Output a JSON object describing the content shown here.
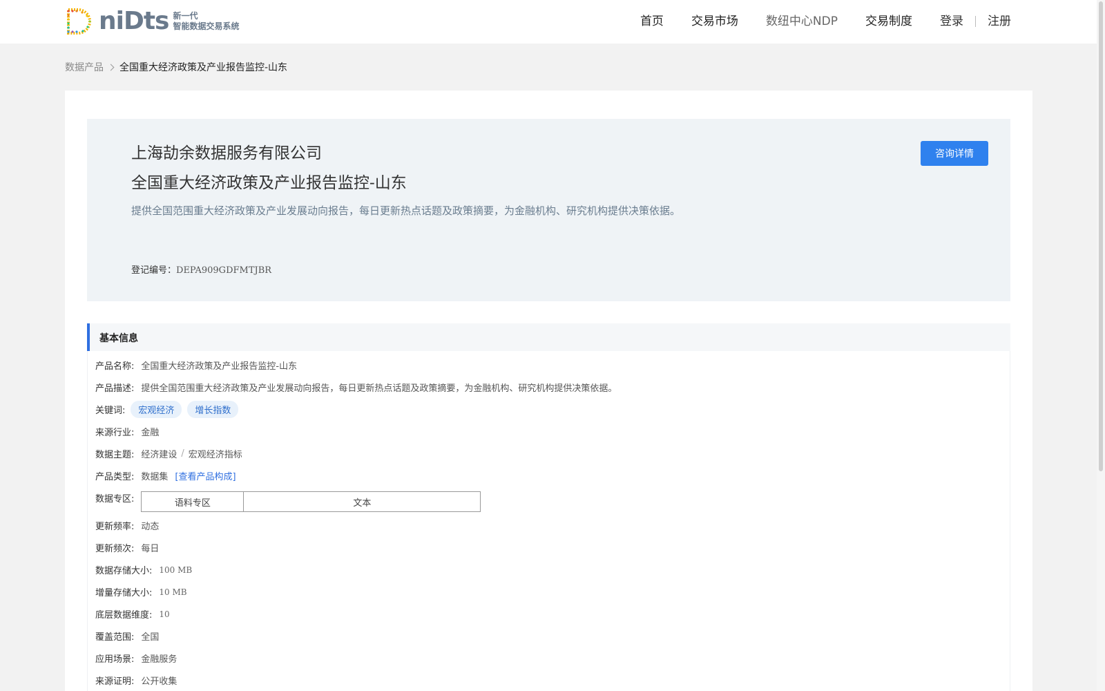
{
  "header": {
    "logo_word": "niDts",
    "logo_line1": "新一代",
    "logo_line2": "智能数据交易系统",
    "nav": [
      {
        "label": "首页"
      },
      {
        "label": "交易市场"
      },
      {
        "label": "数纽中心NDP"
      },
      {
        "label": "交易制度"
      }
    ],
    "login": "登录",
    "register": "注册"
  },
  "breadcrumb": {
    "root": "数据产品",
    "current": "全国重大经济政策及产业报告监控-山东"
  },
  "hero": {
    "company": "上海劼余数据服务有限公司",
    "title": "全国重大经济政策及产业报告监控-山东",
    "description": "提供全国范围重大经济政策及产业发展动向报告，每日更新热点话题及政策摘要，为金融机构、研究机构提供决策依据。",
    "reg_label": "登记编号：",
    "reg_value": "DEPA909GDFMTJBR",
    "consult_button": "咨询详情"
  },
  "basic_info": {
    "section_title": "基本信息",
    "product_name_label": "产品名称:",
    "product_name": "全国重大经济政策及产业报告监控-山东",
    "product_desc_label": "产品描述:",
    "product_desc": "提供全国范围重大经济政策及产业发展动向报告，每日更新热点话题及政策摘要，为金融机构、研究机构提供决策依据。",
    "keywords_label": "关键词:",
    "keywords": [
      "宏观经济",
      "增长指数"
    ],
    "industry_label": "来源行业:",
    "industry": "金融",
    "theme_label": "数据主题:",
    "theme_1": "经济建设",
    "theme_sep": "/",
    "theme_2": "宏观经济指标",
    "type_label": "产品类型:",
    "type": "数据集",
    "type_link": "[查看产品构成]",
    "zone_label": "数据专区:",
    "zone_name": "语料专区",
    "zone_value": "文本",
    "freq_label": "更新频率:",
    "freq": "动态",
    "interval_label": "更新频次:",
    "interval": "每日",
    "storage_label": "数据存储大小:",
    "storage": "100 MB",
    "inc_storage_label": "增量存储大小:",
    "inc_storage": "10 MB",
    "dim_label": "底层数据维度:",
    "dim": "10",
    "coverage_label": "覆盖范围:",
    "coverage": "全国",
    "scenario_label": "应用场景:",
    "scenario": "金融服务",
    "source_label": "来源证明:",
    "source": "公开收集"
  },
  "colors": {
    "accent": "#2f81ee",
    "hero_bg": "#eff3f6",
    "page_bg": "#f2f2f2"
  }
}
